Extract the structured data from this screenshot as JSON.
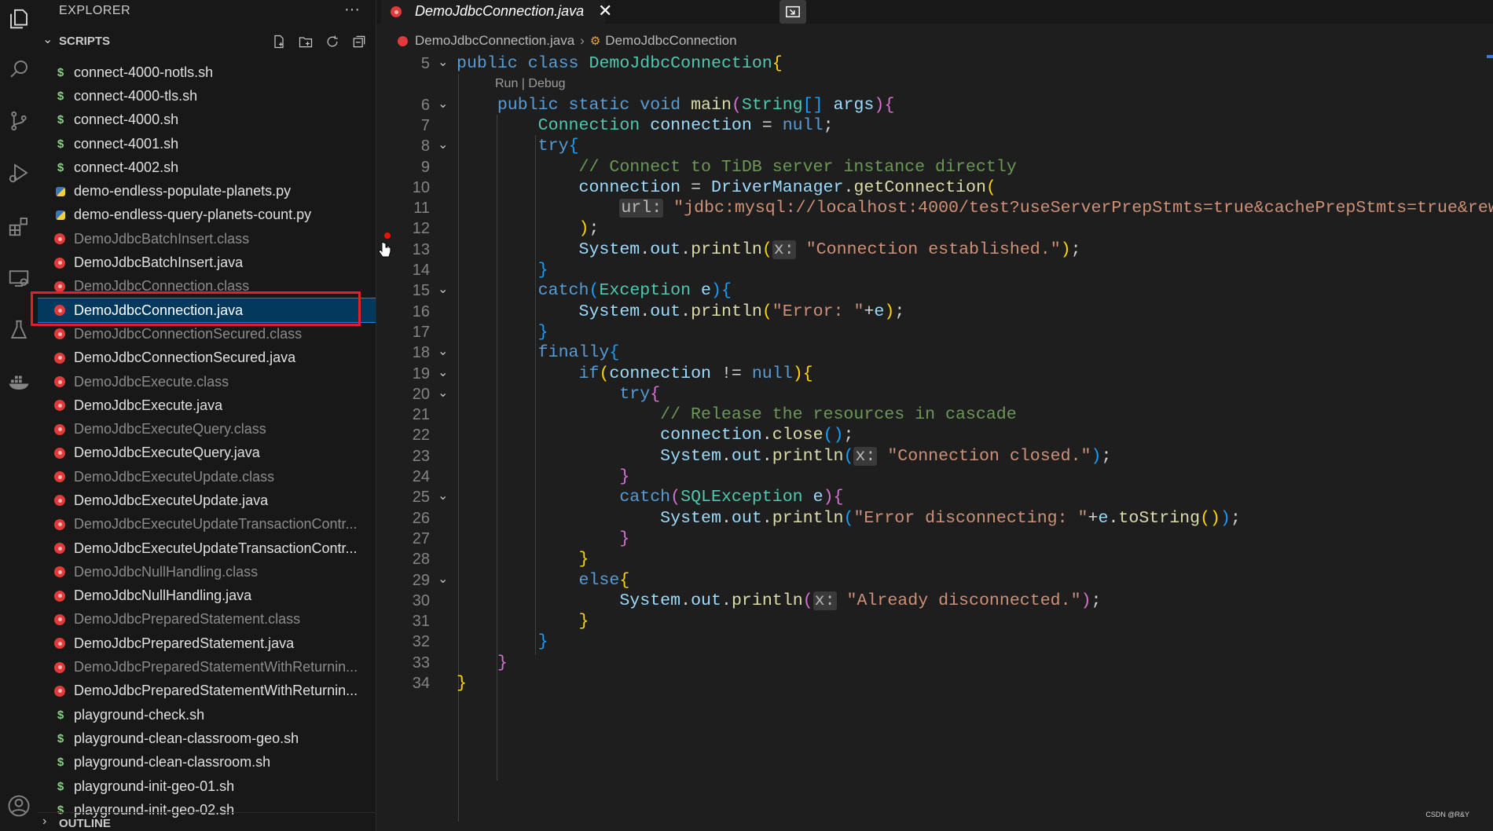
{
  "activity_bar": {
    "icons": [
      "explorer-icon",
      "search-icon",
      "source-control-icon",
      "run-debug-icon",
      "extensions-icon",
      "remote-explorer-icon",
      "testing-icon",
      "docker-icon",
      "account-icon"
    ]
  },
  "sidebar": {
    "title": "EXPLORER",
    "more": "···",
    "section": "SCRIPTS",
    "outline": "OUTLINE",
    "files": [
      {
        "name": "connect-4000-notls.sh",
        "type": "sh",
        "dim": false
      },
      {
        "name": "connect-4000-tls.sh",
        "type": "sh",
        "dim": false
      },
      {
        "name": "connect-4000.sh",
        "type": "sh",
        "dim": false
      },
      {
        "name": "connect-4001.sh",
        "type": "sh",
        "dim": false
      },
      {
        "name": "connect-4002.sh",
        "type": "sh",
        "dim": false
      },
      {
        "name": "demo-endless-populate-planets.py",
        "type": "py",
        "dim": false
      },
      {
        "name": "demo-endless-query-planets-count.py",
        "type": "py",
        "dim": false
      },
      {
        "name": "DemoJdbcBatchInsert.class",
        "type": "java",
        "dim": true
      },
      {
        "name": "DemoJdbcBatchInsert.java",
        "type": "java",
        "dim": false
      },
      {
        "name": "DemoJdbcConnection.class",
        "type": "java",
        "dim": true
      },
      {
        "name": "DemoJdbcConnection.java",
        "type": "java",
        "dim": false,
        "selected": true
      },
      {
        "name": "DemoJdbcConnectionSecured.class",
        "type": "java",
        "dim": true
      },
      {
        "name": "DemoJdbcConnectionSecured.java",
        "type": "java",
        "dim": false
      },
      {
        "name": "DemoJdbcExecute.class",
        "type": "java",
        "dim": true
      },
      {
        "name": "DemoJdbcExecute.java",
        "type": "java",
        "dim": false
      },
      {
        "name": "DemoJdbcExecuteQuery.class",
        "type": "java",
        "dim": true
      },
      {
        "name": "DemoJdbcExecuteQuery.java",
        "type": "java",
        "dim": false
      },
      {
        "name": "DemoJdbcExecuteUpdate.class",
        "type": "java",
        "dim": true
      },
      {
        "name": "DemoJdbcExecuteUpdate.java",
        "type": "java",
        "dim": false
      },
      {
        "name": "DemoJdbcExecuteUpdateTransactionContr...",
        "type": "java",
        "dim": true
      },
      {
        "name": "DemoJdbcExecuteUpdateTransactionContr...",
        "type": "java",
        "dim": false
      },
      {
        "name": "DemoJdbcNullHandling.class",
        "type": "java",
        "dim": true
      },
      {
        "name": "DemoJdbcNullHandling.java",
        "type": "java",
        "dim": false
      },
      {
        "name": "DemoJdbcPreparedStatement.class",
        "type": "java",
        "dim": true
      },
      {
        "name": "DemoJdbcPreparedStatement.java",
        "type": "java",
        "dim": false
      },
      {
        "name": "DemoJdbcPreparedStatementWithReturnin...",
        "type": "java",
        "dim": true
      },
      {
        "name": "DemoJdbcPreparedStatementWithReturnin...",
        "type": "java",
        "dim": false
      },
      {
        "name": "playground-check.sh",
        "type": "sh",
        "dim": false
      },
      {
        "name": "playground-clean-classroom-geo.sh",
        "type": "sh",
        "dim": false
      },
      {
        "name": "playground-clean-classroom.sh",
        "type": "sh",
        "dim": false
      },
      {
        "name": "playground-init-geo-01.sh",
        "type": "sh",
        "dim": false
      },
      {
        "name": "playground-init-geo-02.sh",
        "type": "sh",
        "dim": false
      }
    ]
  },
  "editor": {
    "tab_label": "DemoJdbcConnection.java",
    "tab_close": "✕",
    "breadcrumb": {
      "file": "DemoJdbcConnection.java",
      "symbol": "DemoJdbcConnection"
    },
    "codelens": "Run | Debug",
    "line_numbers": [
      "5",
      "6",
      "7",
      "8",
      "9",
      "10",
      "11",
      "12",
      "13",
      "14",
      "15",
      "16",
      "17",
      "18",
      "19",
      "20",
      "21",
      "22",
      "23",
      "24",
      "25",
      "26",
      "27",
      "28",
      "29",
      "30",
      "31",
      "32",
      "33",
      "34"
    ],
    "folds": [
      "5",
      "6",
      "8",
      "15",
      "18",
      "19",
      "20",
      "25",
      "29"
    ]
  },
  "watermark": "CSDN @R&Y"
}
